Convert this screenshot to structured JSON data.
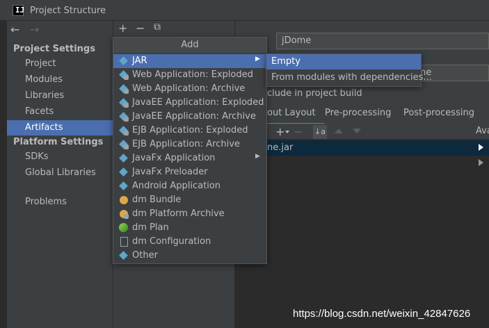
{
  "window": {
    "title": "Project Structure"
  },
  "sidebar": {
    "project_settings_header": "Project Settings",
    "project_items": [
      "Project",
      "Modules",
      "Libraries",
      "Facets",
      "Artifacts"
    ],
    "platform_settings_header": "Platform Settings",
    "platform_items": [
      "SDKs",
      "Global Libraries"
    ],
    "problems": "Problems",
    "selected": "Artifacts"
  },
  "toolbar": {
    "add": "+",
    "remove": "−",
    "copy": "⧉"
  },
  "popup": {
    "title": "Add",
    "items": [
      {
        "label": "JAR",
        "icon": "diamond-icon",
        "submenu": true,
        "selected": true
      },
      {
        "label": "Web Application: Exploded",
        "icon": "web-icon"
      },
      {
        "label": "Web Application: Archive",
        "icon": "web-icon"
      },
      {
        "label": "JavaEE Application: Exploded",
        "icon": "javaee-icon"
      },
      {
        "label": "JavaEE Application: Archive",
        "icon": "javaee-icon"
      },
      {
        "label": "EJB Application: Exploded",
        "icon": "ejb-icon"
      },
      {
        "label": "EJB Application: Archive",
        "icon": "ejb-icon"
      },
      {
        "label": "JavaFx Application",
        "icon": "diamond-icon",
        "submenu": true
      },
      {
        "label": "JavaFx Preloader",
        "icon": "diamond-icon"
      },
      {
        "label": "Android Application",
        "icon": "diamond-icon"
      },
      {
        "label": "dm Bundle",
        "icon": "bundle-icon"
      },
      {
        "label": "dm Platform Archive",
        "icon": "bundle-icon"
      },
      {
        "label": "dm Plan",
        "icon": "plan-icon"
      },
      {
        "label": "dm Configuration",
        "icon": "config-icon"
      },
      {
        "label": "Other",
        "icon": "diamond-icon"
      }
    ]
  },
  "submenu": {
    "items": [
      {
        "label": "Empty",
        "selected": true
      },
      {
        "label": "From modules with dependencies..."
      }
    ]
  },
  "right": {
    "name_value": "jDome",
    "second_field_value": "ne",
    "include_text": "clude in project build",
    "tabs": [
      "out Layout",
      "Pre-processing",
      "Post-processing"
    ],
    "available_label": "Ava",
    "tree_item": "ne.jar"
  },
  "watermark": "https://blog.csdn.net/weixin_42847626"
}
